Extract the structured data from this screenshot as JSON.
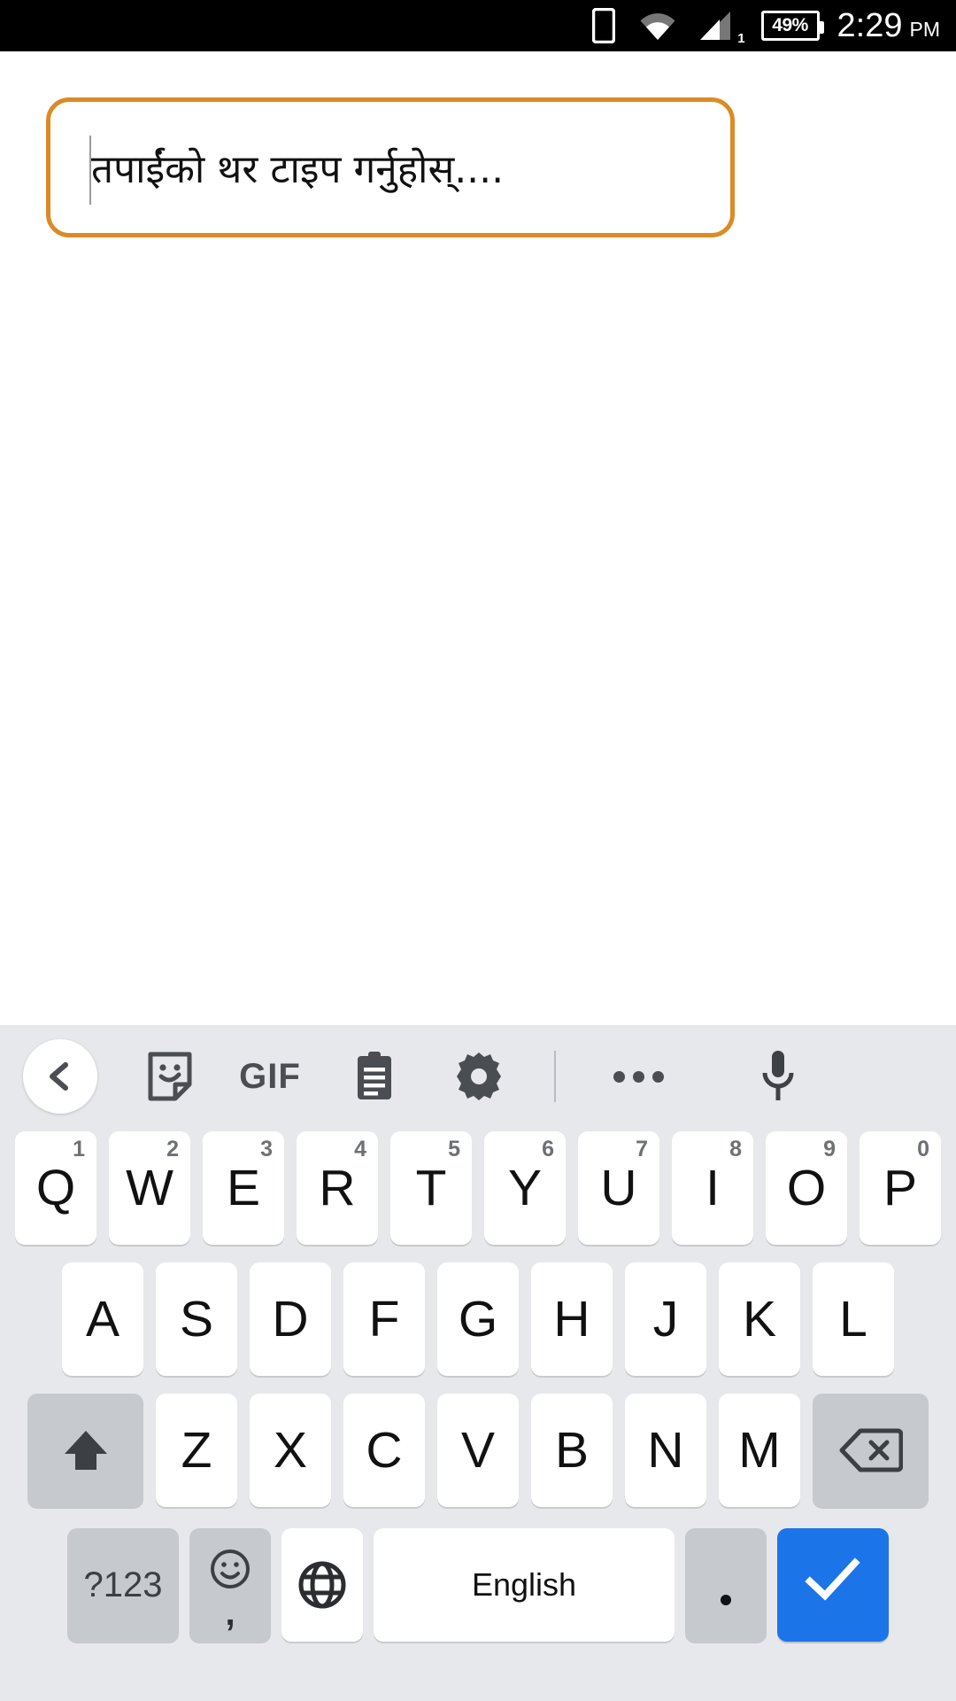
{
  "status_bar": {
    "icons": [
      "phone-icon",
      "wifi-icon",
      "cellular-signal-icon"
    ],
    "sim_label": "1",
    "battery_percent": "49%",
    "time": "2:29",
    "am_pm": "PM"
  },
  "input_field": {
    "value": "",
    "placeholder": "तपाईंको थर टाइप गर्नुहोस्....",
    "border_color": "#db8b26",
    "caret_visible": true
  },
  "keyboard": {
    "background_color": "#e7e8eb",
    "toolbar": {
      "back_label": "‹",
      "gif_label": "GIF",
      "items": [
        {
          "name": "back-icon",
          "label": ""
        },
        {
          "name": "sticker-icon",
          "label": ""
        },
        {
          "name": "gif-icon",
          "label": "GIF"
        },
        {
          "name": "clipboard-icon",
          "label": ""
        },
        {
          "name": "settings-gear-icon",
          "label": ""
        },
        {
          "name": "more-options-icon",
          "label": ""
        },
        {
          "name": "microphone-icon",
          "label": ""
        }
      ]
    },
    "row1": [
      {
        "key": "Q",
        "num": "1"
      },
      {
        "key": "W",
        "num": "2"
      },
      {
        "key": "E",
        "num": "3"
      },
      {
        "key": "R",
        "num": "4"
      },
      {
        "key": "T",
        "num": "5"
      },
      {
        "key": "Y",
        "num": "6"
      },
      {
        "key": "U",
        "num": "7"
      },
      {
        "key": "I",
        "num": "8"
      },
      {
        "key": "O",
        "num": "9"
      },
      {
        "key": "P",
        "num": "0"
      }
    ],
    "row2": [
      "A",
      "S",
      "D",
      "F",
      "G",
      "H",
      "J",
      "K",
      "L"
    ],
    "row3": [
      "Z",
      "X",
      "C",
      "V",
      "B",
      "N",
      "M"
    ],
    "shift_key": "shift-icon",
    "backspace_key": "backspace-icon",
    "row4": {
      "symbols_label": "?123",
      "emoji_comma_label": ",",
      "globe_label": "globe-icon",
      "space_label": "English",
      "period_label": ".",
      "enter_label": "check-icon",
      "enter_color": "#1b74e8"
    }
  }
}
